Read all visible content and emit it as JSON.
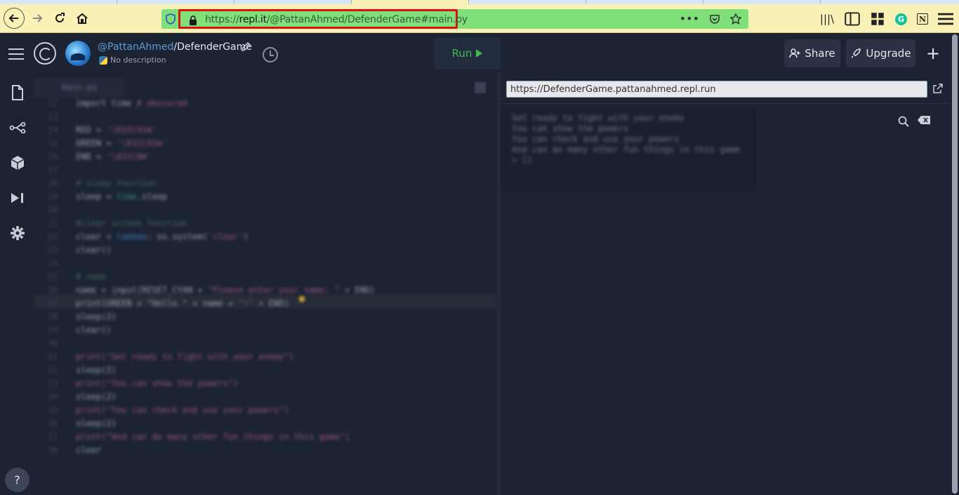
{
  "browser": {
    "url_scheme": "https://",
    "url_host": "repl.it",
    "url_path": "/@PattanAhmed/DefenderGame#main.py",
    "highlight_color": "#e01010",
    "urlbar_color": "#7fe07a",
    "toolbar_color": "#f9f1b5"
  },
  "header": {
    "owner": "@PattanAhmed",
    "separator": "/",
    "repl_name": "DefenderGame",
    "description": "No description",
    "run_label": "Run",
    "share_label": "Share",
    "upgrade_label": "Upgrade",
    "plus_label": "+",
    "run_color": "#3fb950"
  },
  "sidebar": {
    "icons": [
      "files-icon",
      "version-control-icon",
      "packages-icon",
      "debugger-icon",
      "settings-icon"
    ],
    "help_label": "?"
  },
  "editor": {
    "tab_label": "main.py",
    "lines": [
      {
        "n": "12",
        "parts": [
          [
            "c-kw",
            "import"
          ],
          [
            "c-kw",
            " time "
          ],
          [
            "c-str",
            "# obscured"
          ]
        ]
      },
      {
        "n": "13",
        "parts": []
      },
      {
        "n": "14",
        "parts": [
          [
            "c-kw",
            "RED   = "
          ],
          [
            "c-str",
            "'\\033[91m'"
          ]
        ]
      },
      {
        "n": "15",
        "parts": [
          [
            "c-kw",
            "GREEN     = "
          ],
          [
            "c-str",
            "'\\033[92m'"
          ]
        ]
      },
      {
        "n": "16",
        "parts": [
          [
            "c-kw",
            "END   = "
          ],
          [
            "c-str",
            "'\\033[0m'"
          ]
        ]
      },
      {
        "n": "17",
        "parts": []
      },
      {
        "n": "18",
        "parts": [
          [
            "c-com",
            "# sleep function"
          ]
        ]
      },
      {
        "n": "19",
        "parts": [
          [
            "c-kw",
            "sleep = "
          ],
          [
            "c-fn",
            "time"
          ],
          [
            "c-kw",
            ".sleep"
          ]
        ]
      },
      {
        "n": "20",
        "parts": []
      },
      {
        "n": "21",
        "parts": [
          [
            "c-com",
            "#clear screen function"
          ]
        ]
      },
      {
        "n": "22",
        "parts": [
          [
            "c-kw",
            "clear = "
          ],
          [
            "c-blu",
            "lambda"
          ],
          [
            "c-kw",
            ": os.system("
          ],
          [
            "c-str",
            "'clear'"
          ],
          [
            "c-kw",
            ")"
          ]
        ]
      },
      {
        "n": "23",
        "parts": [
          [
            "c-kw",
            "clear()"
          ]
        ]
      },
      {
        "n": "24",
        "parts": []
      },
      {
        "n": "25",
        "parts": [
          [
            "c-com",
            "# name"
          ]
        ]
      },
      {
        "n": "26",
        "parts": [
          [
            "c-kw",
            "name = input(RESET_CYAN + "
          ],
          [
            "c-str",
            "\"Please enter your name: \""
          ],
          [
            "c-kw",
            " + END)"
          ]
        ]
      },
      {
        "n": "27",
        "parts": [
          [
            "c-kw",
            "print(GREEN + \"Hello \" + name + "
          ],
          [
            "c-str",
            "\"!\""
          ],
          [
            "c-kw",
            " + END)"
          ]
        ]
      },
      {
        "n": "28",
        "parts": [
          [
            "c-kw",
            "sleep(2)"
          ]
        ]
      },
      {
        "n": "29",
        "parts": [
          [
            "c-kw",
            "clear()"
          ]
        ]
      },
      {
        "n": "30",
        "parts": []
      },
      {
        "n": "31",
        "parts": [
          [
            "c-str",
            "print(\"Get ready to fight with your enemy\")"
          ]
        ]
      },
      {
        "n": "32",
        "parts": [
          [
            "c-kw",
            "sleep(2)"
          ]
        ]
      },
      {
        "n": "33",
        "parts": [
          [
            "c-str",
            "print(\"You can show the powers\")"
          ]
        ]
      },
      {
        "n": "34",
        "parts": [
          [
            "c-kw",
            "sleep(2)"
          ]
        ]
      },
      {
        "n": "35",
        "parts": [
          [
            "c-str",
            "print(\"You can check and use your powers\")"
          ]
        ]
      },
      {
        "n": "36",
        "parts": [
          [
            "c-kw",
            "sleep(2)"
          ]
        ]
      },
      {
        "n": "37",
        "parts": [
          [
            "c-str",
            "print(\"And can do many other fun things in this game\")"
          ]
        ]
      },
      {
        "n": "38",
        "parts": [
          [
            "c-kw",
            "clear"
          ]
        ]
      }
    ]
  },
  "webview": {
    "url": "https://DefenderGame.pattanahmed.repl.run",
    "console_lines": [
      "Get ready to fight with your enemy",
      "You can show the powers",
      "You can check and use your powers",
      "And can do many other fun things in this game",
      "> []"
    ]
  }
}
